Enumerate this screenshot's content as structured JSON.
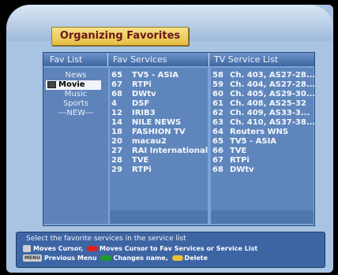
{
  "title": "Organizing Favorites",
  "headers": {
    "fav_list": "Fav List",
    "fav_services": "Fav Services",
    "tv_service_list": "TV Service List"
  },
  "fav_list": [
    "News",
    "Movie",
    "Music",
    "Sports",
    "---NEW---"
  ],
  "selected_fav": "Movie",
  "fav_services": [
    {
      "num": "65",
      "name": "TV5 - ASIA"
    },
    {
      "num": "67",
      "name": "RTPi"
    },
    {
      "num": "68",
      "name": "DWtv"
    },
    {
      "num": "4",
      "name": "DSF"
    },
    {
      "num": "12",
      "name": "IRIB3"
    },
    {
      "num": "14",
      "name": "NILE NEWS"
    },
    {
      "num": "18",
      "name": "FASHION TV"
    },
    {
      "num": "20",
      "name": "macau2"
    },
    {
      "num": "27",
      "name": "RAI International"
    },
    {
      "num": "28",
      "name": "TVE"
    },
    {
      "num": "29",
      "name": "RTPi"
    }
  ],
  "tv_services": [
    {
      "num": "58",
      "name": "Ch. 403, AS27-28..."
    },
    {
      "num": "59",
      "name": "Ch. 404, AS27-28..."
    },
    {
      "num": "60",
      "name": "Ch. 405, AS29-30..."
    },
    {
      "num": "61",
      "name": "Ch. 408, AS25-32"
    },
    {
      "num": "62",
      "name": "Ch. 409,  AS33-3..."
    },
    {
      "num": "63",
      "name": "Ch. 410, AS37-38..."
    },
    {
      "num": "64",
      "name": "Reuters WNS"
    },
    {
      "num": "65",
      "name": "TV5 - ASIA"
    },
    {
      "num": "66",
      "name": "TVE"
    },
    {
      "num": "67",
      "name": "RTPi"
    },
    {
      "num": "68",
      "name": "DWtv"
    }
  ],
  "info": {
    "title": "Select the favorite services in the service list",
    "moves_cursor": "Moves Cursor,",
    "moves_cursor_to": "Moves Cursor to Fav Services or Service List",
    "menu_key": "MENU",
    "previous_menu": "Previous Menu",
    "changes_name": "Changes name,",
    "delete": "Delete"
  },
  "colors": {
    "red": "#e02020",
    "green": "#1f9a2a",
    "yellow": "#e8c23a"
  }
}
